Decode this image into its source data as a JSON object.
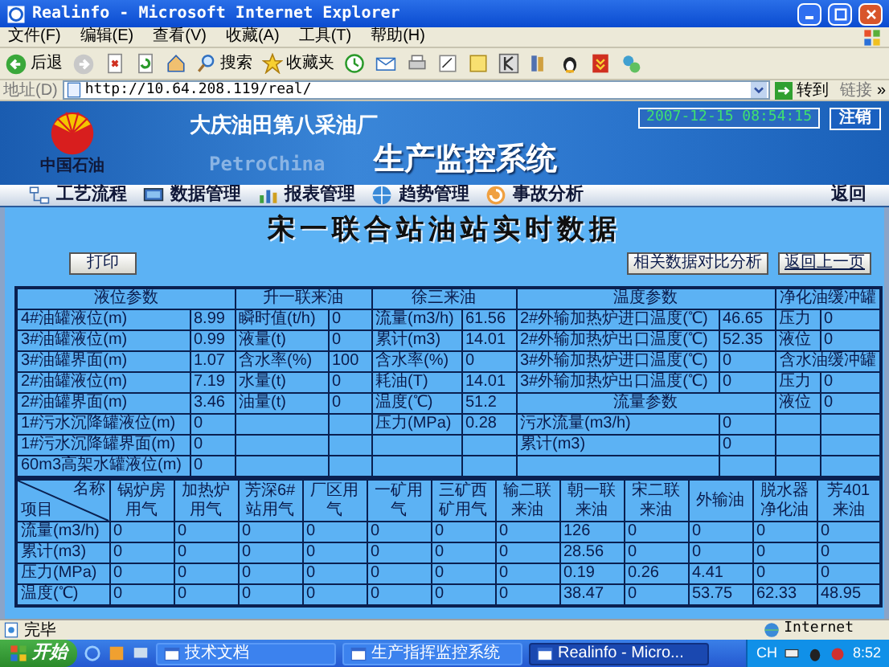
{
  "window": {
    "title": "Realinfo - Microsoft Internet Explorer"
  },
  "menu": [
    "文件(F)",
    "编辑(E)",
    "查看(V)",
    "收藏(A)",
    "工具(T)",
    "帮助(H)"
  ],
  "toolbar": {
    "back": "后退",
    "search": "搜索",
    "favorites": "收藏夹"
  },
  "address": {
    "label": "地址(D)",
    "value": "http://10.64.208.119/real/",
    "go": "转到",
    "links": "链接",
    "more": "»"
  },
  "header": {
    "logo_text": "中国石油",
    "company": "大庆油田第八采油厂",
    "brand_text": "PetroChina",
    "system_title": "生产监控系统",
    "datetime": "2007-12-15 08:54:15",
    "logout": "注销"
  },
  "nav": [
    {
      "label": "工艺流程"
    },
    {
      "label": "数据管理"
    },
    {
      "label": "报表管理"
    },
    {
      "label": "趋势管理"
    },
    {
      "label": "事故分析"
    }
  ],
  "nav_back": "返回",
  "page_title": "宋一联合站油站实时数据",
  "buttons": {
    "print": "打印",
    "compare": "相关数据对比分析",
    "back": "返回上一页"
  },
  "table1": {
    "header": [
      {
        "text": "液位参数",
        "colspan": 2
      },
      {
        "text": "升一联来油",
        "colspan": 2
      },
      {
        "text": "徐三来油",
        "colspan": 2
      },
      {
        "text": "温度参数",
        "colspan": 2
      },
      {
        "text": "净化油缓冲罐",
        "colspan": 2
      }
    ],
    "rows": [
      [
        {
          "kind": "label",
          "text": "4#油罐液位(m)"
        },
        {
          "kind": "value",
          "text": "8.99"
        },
        {
          "kind": "label",
          "text": "瞬时值(t/h)"
        },
        {
          "kind": "value",
          "text": "0"
        },
        {
          "kind": "label",
          "text": "流量(m3/h)"
        },
        {
          "kind": "value",
          "text": "61.56"
        },
        {
          "kind": "label",
          "text": "2#外输加热炉进口温度(℃)"
        },
        {
          "kind": "value",
          "text": "46.65"
        },
        {
          "kind": "label",
          "text": "压力"
        },
        {
          "kind": "value",
          "text": "0"
        }
      ],
      [
        {
          "kind": "label",
          "text": "3#油罐液位(m)"
        },
        {
          "kind": "value",
          "text": "0.99"
        },
        {
          "kind": "label",
          "text": "液量(t)"
        },
        {
          "kind": "value",
          "text": "0"
        },
        {
          "kind": "label",
          "text": "累计(m3)"
        },
        {
          "kind": "value",
          "text": "14.01"
        },
        {
          "kind": "label",
          "text": "2#外输加热炉出口温度(℃)"
        },
        {
          "kind": "value",
          "text": "52.35"
        },
        {
          "kind": "label",
          "text": "液位"
        },
        {
          "kind": "value",
          "text": "0"
        }
      ],
      [
        {
          "kind": "label",
          "text": "3#油罐界面(m)"
        },
        {
          "kind": "value",
          "text": "1.07"
        },
        {
          "kind": "label",
          "text": "含水率(%)"
        },
        {
          "kind": "value",
          "text": "100"
        },
        {
          "kind": "label",
          "text": "含水率(%)"
        },
        {
          "kind": "value",
          "text": "0"
        },
        {
          "kind": "label",
          "text": "3#外输加热炉进口温度(℃)"
        },
        {
          "kind": "value",
          "text": "0"
        },
        {
          "kind": "section",
          "text": "含水油缓冲罐",
          "colspan": 2
        }
      ],
      [
        {
          "kind": "label",
          "text": "2#油罐液位(m)"
        },
        {
          "kind": "value",
          "text": "7.19"
        },
        {
          "kind": "label",
          "text": "水量(t)"
        },
        {
          "kind": "value",
          "text": "0"
        },
        {
          "kind": "label",
          "text": "耗油(T)"
        },
        {
          "kind": "value",
          "text": "14.01"
        },
        {
          "kind": "label",
          "text": "3#外输加热炉出口温度(℃)"
        },
        {
          "kind": "value",
          "text": "0"
        },
        {
          "kind": "label",
          "text": "压力"
        },
        {
          "kind": "value",
          "text": "0"
        }
      ],
      [
        {
          "kind": "label",
          "text": "2#油罐界面(m)"
        },
        {
          "kind": "value",
          "text": "3.46"
        },
        {
          "kind": "label",
          "text": "油量(t)"
        },
        {
          "kind": "value",
          "text": "0"
        },
        {
          "kind": "label",
          "text": "温度(℃)"
        },
        {
          "kind": "value",
          "text": "51.2"
        },
        {
          "kind": "section",
          "text": "流量参数",
          "colspan": 2
        },
        {
          "kind": "label",
          "text": "液位"
        },
        {
          "kind": "value",
          "text": "0"
        }
      ],
      [
        {
          "kind": "label",
          "text": "1#污水沉降罐液位(m)"
        },
        {
          "kind": "value",
          "text": "0"
        },
        {
          "kind": "blank"
        },
        {
          "kind": "blank"
        },
        {
          "kind": "label",
          "text": "压力(MPa)"
        },
        {
          "kind": "value",
          "text": "0.28"
        },
        {
          "kind": "label",
          "text": "污水流量(m3/h)"
        },
        {
          "kind": "value",
          "text": "0"
        },
        {
          "kind": "blank"
        },
        {
          "kind": "blank"
        }
      ],
      [
        {
          "kind": "label",
          "text": "1#污水沉降罐界面(m)"
        },
        {
          "kind": "value",
          "text": "0"
        },
        {
          "kind": "blank"
        },
        {
          "kind": "blank"
        },
        {
          "kind": "blank"
        },
        {
          "kind": "blank"
        },
        {
          "kind": "label",
          "text": "累计(m3)"
        },
        {
          "kind": "value",
          "text": "0"
        },
        {
          "kind": "blank"
        },
        {
          "kind": "blank"
        }
      ],
      [
        {
          "kind": "label",
          "text": "60m3高架水罐液位(m)"
        },
        {
          "kind": "value",
          "text": "0"
        },
        {
          "kind": "blank"
        },
        {
          "kind": "blank"
        },
        {
          "kind": "blank"
        },
        {
          "kind": "blank"
        },
        {
          "kind": "blank"
        },
        {
          "kind": "blank"
        },
        {
          "kind": "blank"
        },
        {
          "kind": "blank"
        }
      ]
    ]
  },
  "table2": {
    "corner_top": "名称",
    "corner_bottom": "项目",
    "columns": [
      "锅炉房用气",
      "加热炉用气",
      "芳深6#站用气",
      "厂区用气",
      "一矿用气",
      "三矿西矿用气",
      "输二联来油",
      "朝一联来油",
      "宋二联来油",
      "外输油",
      "脱水器净化油",
      "芳401来油"
    ],
    "rows": [
      {
        "label": "流量(m3/h)",
        "values": [
          "0",
          "0",
          "0",
          "0",
          "0",
          "0",
          "0",
          "126",
          "0",
          "0",
          "0",
          "0"
        ]
      },
      {
        "label": "累计(m3)",
        "values": [
          "0",
          "0",
          "0",
          "0",
          "0",
          "0",
          "0",
          "28.56",
          "0",
          "0",
          "0",
          "0"
        ]
      },
      {
        "label": "压力(MPa)",
        "values": [
          "0",
          "0",
          "0",
          "0",
          "0",
          "0",
          "0",
          "0.19",
          "0.26",
          "4.41",
          "0",
          "0"
        ]
      },
      {
        "label": "温度(℃)",
        "values": [
          "0",
          "0",
          "0",
          "0",
          "0",
          "0",
          "0",
          "38.47",
          "0",
          "53.75",
          "62.33",
          "48.95"
        ]
      }
    ]
  },
  "status_bar": {
    "text": "完毕",
    "zone": "Internet"
  },
  "taskbar": {
    "start": "开始",
    "items": [
      {
        "label": "技术文档",
        "selected": false
      },
      {
        "label": "生产指挥监控系统",
        "selected": false
      },
      {
        "label": "Realinfo - Micro...",
        "selected": true
      }
    ],
    "ime": "CH",
    "clock": "8:52"
  }
}
